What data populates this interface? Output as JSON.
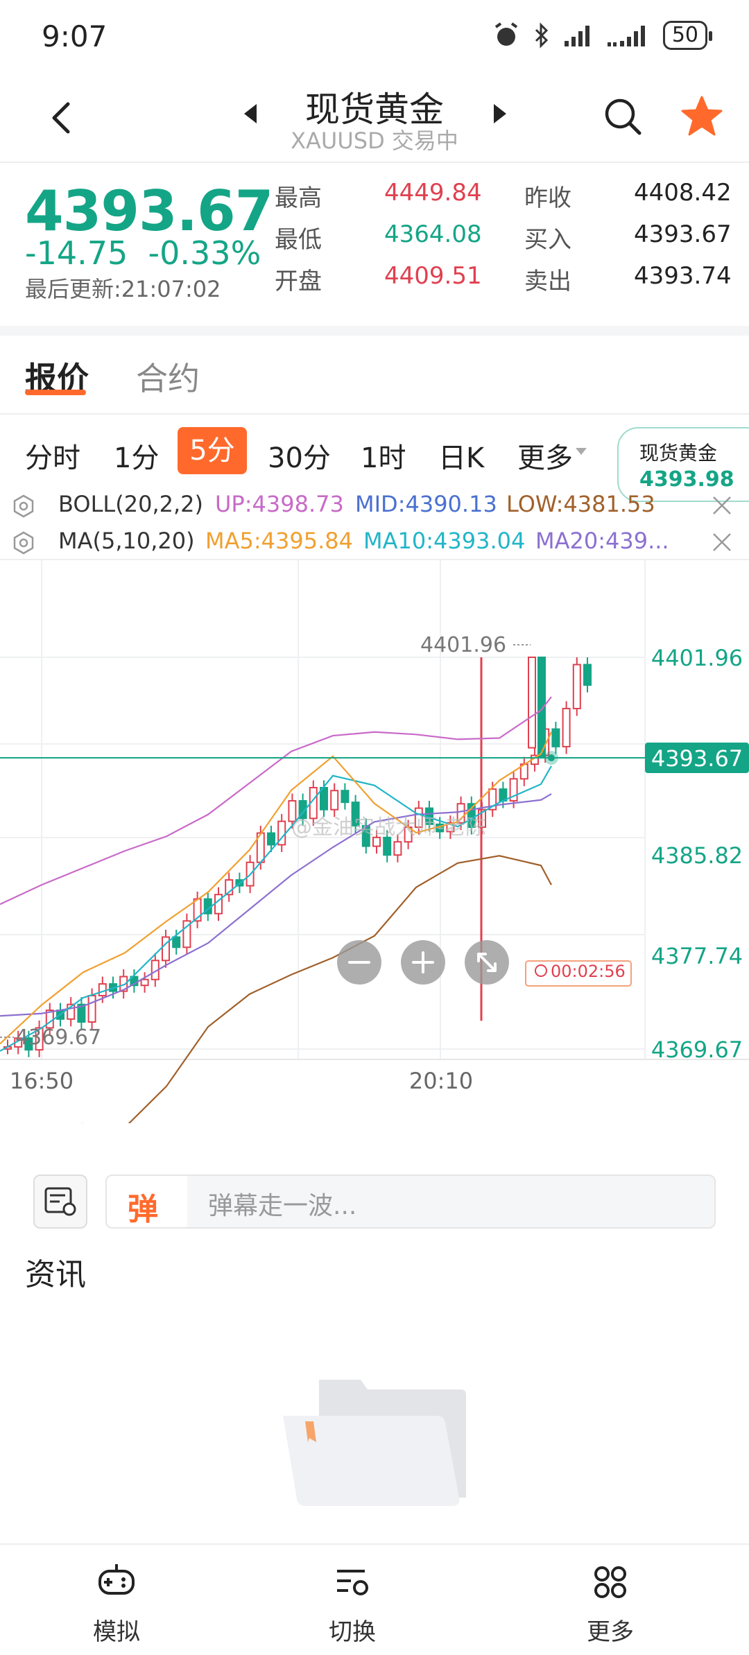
{
  "status_bar": {
    "time": "9:07",
    "battery": "50"
  },
  "header": {
    "title": "现货黄金",
    "subtitle": "XAUUSD 交易中"
  },
  "quote": {
    "price": "4393.67",
    "change": "-14.75",
    "change_pct": "-0.33%",
    "last_update": "最后更新:21:07:02",
    "stats": [
      {
        "label": "最高",
        "value": "4449.84",
        "color": "#e0404f"
      },
      {
        "label": "最低",
        "value": "4364.08",
        "color": "#14a586"
      },
      {
        "label": "开盘",
        "value": "4409.51",
        "color": "#e0404f"
      },
      {
        "label": "昨收",
        "value": "4408.42",
        "color": "#222222"
      },
      {
        "label": "买入",
        "value": "4393.67",
        "color": "#222222"
      },
      {
        "label": "卖出",
        "value": "4393.74",
        "color": "#222222"
      }
    ]
  },
  "tabs": {
    "active": "报价",
    "other": "合约"
  },
  "periods": [
    "分时",
    "1分",
    "5分",
    "30分",
    "1时",
    "日K",
    "更多"
  ],
  "active_period": "5分",
  "favorite_badge": {
    "name": "现货黄金",
    "price": "4393.98"
  },
  "indicators": {
    "boll": {
      "name": "BOLL(20,2,2)",
      "up": "UP:4398.73",
      "mid": "MID:4390.13",
      "low": "LOW:4381.53"
    },
    "ma": {
      "name": "MA(5,10,20)",
      "ma5": "MA5:4395.84",
      "ma10": "MA10:4393.04",
      "ma20": "MA20:439..."
    }
  },
  "colors": {
    "up": "#e0404f",
    "down": "#14a586",
    "accent": "#ff6a2c",
    "ma5": "#f0a030",
    "ma10": "#22b5c8",
    "ma20": "#8c70d0",
    "boll_up": "#c86ac8",
    "boll_low": "#a0602a"
  },
  "chart_data": {
    "type": "candlestick",
    "y_ticks": [
      "4401.96",
      "4385.82",
      "4377.74",
      "4369.67"
    ],
    "current_price_label": "4393.67",
    "high_marker": "4401.96",
    "low_marker": "4369.67",
    "x_ticks": [
      "16:50",
      "20:10"
    ],
    "ylim": [
      4362,
      4408
    ],
    "timer": "00:02:56",
    "watermark": "@金油实战大师-老陈"
  },
  "danmaku": {
    "tag": "弹",
    "placeholder": "弹幕走一波..."
  },
  "news": {
    "title": "资讯"
  },
  "bottom_nav": [
    {
      "label": "模拟",
      "icon": "gamepad-icon"
    },
    {
      "label": "切换",
      "icon": "switch-list-icon"
    },
    {
      "label": "更多",
      "icon": "grid-more-icon"
    }
  ]
}
